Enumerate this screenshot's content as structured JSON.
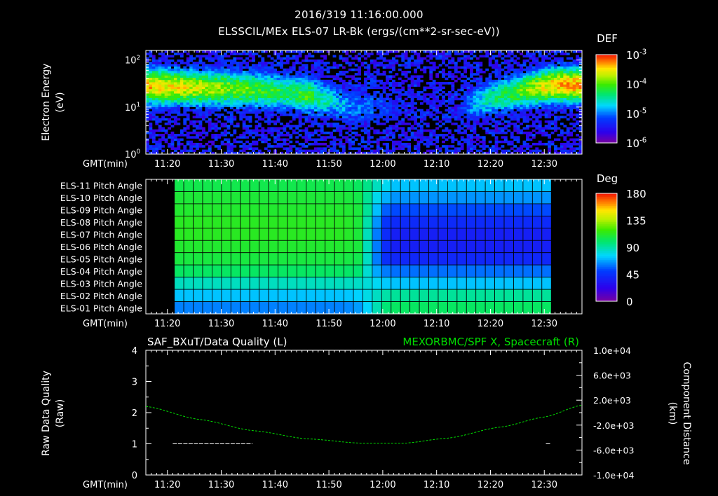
{
  "header": {
    "timestamp": "2016/319 11:16:00.000",
    "subtitle": "ELSSCIL/MEx ELS-07 LR-Bk  (ergs/(cm**2-sr-sec-eV))"
  },
  "time_axis": {
    "label": "GMT(min)",
    "range_min": [
      16,
      97
    ],
    "tick_minutes": [
      20,
      30,
      40,
      50,
      60,
      70,
      80,
      90
    ],
    "tick_labels": [
      "11:20",
      "11:30",
      "11:40",
      "11:50",
      "12:00",
      "12:10",
      "12:20",
      "12:30"
    ]
  },
  "colors": {
    "trace": "#00dd00",
    "quality": "#ffffff",
    "background": "#000000",
    "gridline": "#000000"
  },
  "chart_data": [
    {
      "type": "heatmap",
      "title": "",
      "ylabel": "Electron Energy",
      "yunits": "(eV)",
      "yscale": "log",
      "ylim": [
        1,
        160
      ],
      "ytick_labels": [
        {
          "value": 1,
          "base": "10",
          "exp": "0"
        },
        {
          "value": 10,
          "base": "10",
          "exp": "1"
        },
        {
          "value": 100,
          "base": "10",
          "exp": "2"
        }
      ],
      "colorbar": {
        "title": "DEF",
        "scale": "log",
        "range": [
          1e-06,
          0.001
        ],
        "tick_labels": [
          {
            "value": 0.001,
            "base": "10",
            "exp": "-3"
          },
          {
            "value": 0.0001,
            "base": "10",
            "exp": "-4"
          },
          {
            "value": 1e-05,
            "base": "10",
            "exp": "-5"
          },
          {
            "value": 1e-06,
            "base": "10",
            "exp": "-6"
          }
        ]
      },
      "flux_band": [
        {
          "t": 16,
          "peak_eV": 28,
          "level": 0.86,
          "low_eV": 5
        },
        {
          "t": 25,
          "peak_eV": 26,
          "level": 0.78,
          "low_eV": 6
        },
        {
          "t": 35,
          "peak_eV": 24,
          "level": 0.66,
          "low_eV": 6
        },
        {
          "t": 43,
          "peak_eV": 20,
          "level": 0.58,
          "low_eV": 6
        },
        {
          "t": 46,
          "peak_eV": 18,
          "level": 0.64,
          "low_eV": 6
        },
        {
          "t": 50,
          "peak_eV": 14,
          "level": 0.46,
          "low_eV": 6
        },
        {
          "t": 54,
          "peak_eV": 10,
          "level": 0.34,
          "low_eV": 4
        },
        {
          "t": 58,
          "peak_eV": 10,
          "level": 0.3,
          "low_eV": 5
        },
        {
          "t": 64,
          "peak_eV": 10,
          "level": 0.16,
          "low_eV": 5
        },
        {
          "t": 73,
          "peak_eV": 10,
          "level": 0.1,
          "low_eV": 5
        },
        {
          "t": 77,
          "peak_eV": 12,
          "level": 0.4,
          "low_eV": 6
        },
        {
          "t": 84,
          "peak_eV": 20,
          "level": 0.62,
          "low_eV": 6
        },
        {
          "t": 92,
          "peak_eV": 30,
          "level": 0.86,
          "low_eV": 6
        },
        {
          "t": 97,
          "peak_eV": 30,
          "level": 0.9,
          "low_eV": 6
        }
      ]
    },
    {
      "type": "heatmap",
      "title": "",
      "ylabel": "",
      "row_labels": [
        "ELS-11 Pitch Angle",
        "ELS-10 Pitch Angle",
        "ELS-09 Pitch Angle",
        "ELS-08 Pitch Angle",
        "ELS-07 Pitch Angle",
        "ELS-06 Pitch Angle",
        "ELS-05 Pitch Angle",
        "ELS-04 Pitch Angle",
        "ELS-03 Pitch Angle",
        "ELS-02 Pitch Angle",
        "ELS-01 Pitch Angle"
      ],
      "colorbar": {
        "title": "Deg",
        "range": [
          0,
          180
        ],
        "tick_labels": [
          "180",
          "135",
          "90",
          "45",
          "0"
        ]
      },
      "data_span_min": [
        21.3,
        91.3
      ],
      "columns_min": [
        21.3,
        53,
        56,
        58,
        60.2,
        62,
        91.3
      ],
      "values_deg": [
        [
          105,
          105,
          100,
          86,
          72,
          62,
          62
        ],
        [
          110,
          110,
          105,
          78,
          60,
          52,
          52
        ],
        [
          112,
          112,
          108,
          75,
          42,
          36,
          36
        ],
        [
          115,
          115,
          108,
          68,
          30,
          22,
          22
        ],
        [
          115,
          115,
          108,
          62,
          26,
          15,
          15
        ],
        [
          112,
          112,
          108,
          62,
          26,
          15,
          15
        ],
        [
          108,
          108,
          104,
          62,
          26,
          20,
          20
        ],
        [
          100,
          100,
          96,
          62,
          48,
          44,
          44
        ],
        [
          80,
          80,
          78,
          72,
          64,
          62,
          62
        ],
        [
          62,
          62,
          66,
          76,
          84,
          88,
          88
        ],
        [
          48,
          48,
          55,
          74,
          94,
          100,
          100
        ]
      ]
    },
    {
      "type": "line",
      "title_left": "SAF_BXuT/Data Quality (L)",
      "title_right": "MEXORBMC/SPF X, Spacecraft (R)",
      "ylabel": "Raw Data Quality",
      "yunits": "(Raw)",
      "ylim": [
        0,
        4
      ],
      "ytick_labels": [
        "0",
        "1",
        "2",
        "3",
        "4"
      ],
      "y2label": "Component Distance",
      "y2units": "(km)",
      "y2lim": [
        -10000,
        10000
      ],
      "y2tick_labels": [
        "1.0e+04",
        "6.0e+03",
        "2.0e+03",
        "-2.0e+03",
        "-6.0e+03",
        "-1.0e+04"
      ],
      "series": [
        {
          "axis": "left",
          "segments": [
            {
              "x": [
                21,
                35.8
              ],
              "y": 1
            },
            {
              "x": [
                20.6,
                21.1
              ],
              "y": 0
            },
            {
              "x": [
                35.8,
                90.5
              ],
              "y": 0
            },
            {
              "x": [
                90.3,
                91.2
              ],
              "y": 1
            }
          ]
        },
        {
          "axis": "right",
          "x": [
            16,
            26,
            36,
            46,
            56,
            64,
            72,
            82,
            90,
            97
          ],
          "y": [
            1000,
            -1100,
            -2900,
            -4200,
            -4900,
            -4900,
            -4100,
            -2300,
            -700,
            1200
          ]
        }
      ]
    }
  ]
}
